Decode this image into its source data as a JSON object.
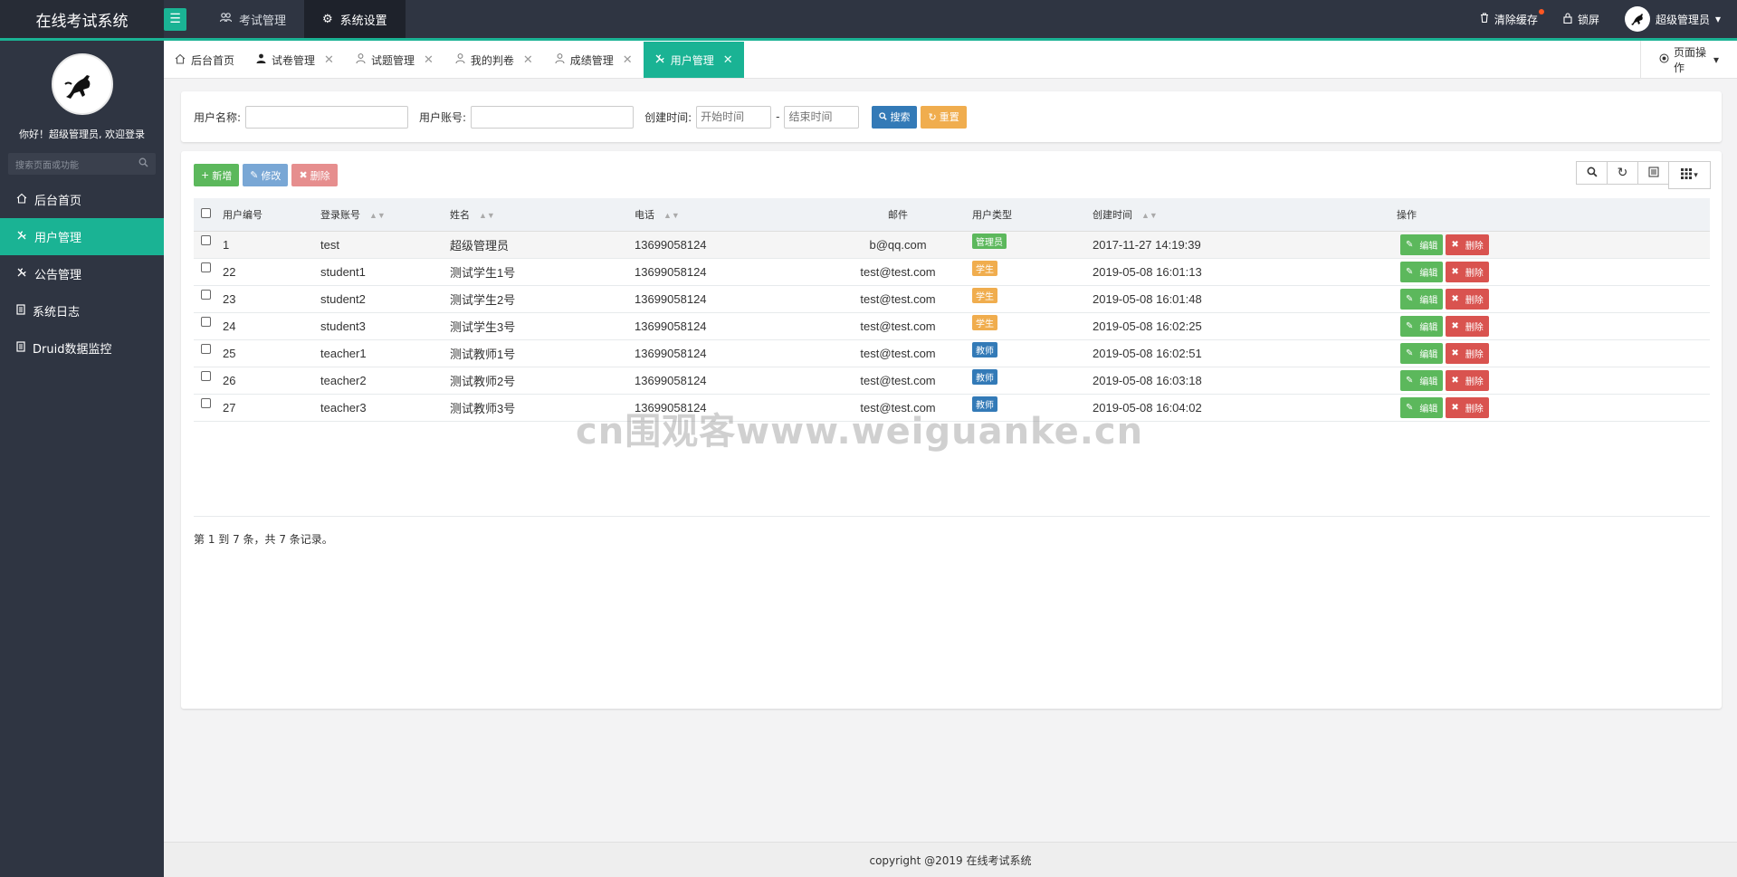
{
  "app": {
    "title": "在线考试系统"
  },
  "topnav": {
    "items": [
      {
        "label": "考试管理",
        "icon": "users-icon",
        "active": false
      },
      {
        "label": "系统设置",
        "icon": "gear-icon",
        "active": true
      }
    ],
    "clear_cache": "清除缓存",
    "lock": "锁屏",
    "user": "超级管理员"
  },
  "sidebar": {
    "welcome": "你好！超级管理员, 欢迎登录",
    "search_placeholder": "搜索页面或功能",
    "items": [
      {
        "label": "后台首页",
        "icon": "home-icon",
        "active": false
      },
      {
        "label": "用户管理",
        "icon": "wrench-icon",
        "active": true
      },
      {
        "label": "公告管理",
        "icon": "wrench-icon",
        "active": false
      },
      {
        "label": "系统日志",
        "icon": "file-icon",
        "active": false
      },
      {
        "label": "Druid数据监控",
        "icon": "file-icon",
        "active": false
      }
    ]
  },
  "tabs": [
    {
      "label": "后台首页",
      "closable": false
    },
    {
      "label": "试卷管理",
      "closable": true
    },
    {
      "label": "试题管理",
      "closable": true
    },
    {
      "label": "我的判卷",
      "closable": true
    },
    {
      "label": "成绩管理",
      "closable": true
    },
    {
      "label": "用户管理",
      "closable": true,
      "active": true
    }
  ],
  "page_ops": "页面操作",
  "search": {
    "username_label": "用户名称:",
    "account_label": "用户账号:",
    "created_label": "创建时间:",
    "start_placeholder": "开始时间",
    "end_placeholder": "结束时间",
    "dash": "-",
    "search_btn": "搜索",
    "reset_btn": "重置"
  },
  "toolbar": {
    "add": "新增",
    "edit": "修改",
    "delete": "删除"
  },
  "table": {
    "headers": [
      "用户编号",
      "登录账号",
      "姓名",
      "电话",
      "邮件",
      "用户类型",
      "创建时间",
      "操作"
    ],
    "rows": [
      {
        "id": "1",
        "account": "test",
        "name": "超级管理员",
        "phone": "13699058124",
        "email": "b@qq.com",
        "type": "管理员",
        "created": "2017-11-27 14:19:39"
      },
      {
        "id": "22",
        "account": "student1",
        "name": "测试学生1号",
        "phone": "13699058124",
        "email": "test@test.com",
        "type": "学生",
        "created": "2019-05-08 16:01:13"
      },
      {
        "id": "23",
        "account": "student2",
        "name": "测试学生2号",
        "phone": "13699058124",
        "email": "test@test.com",
        "type": "学生",
        "created": "2019-05-08 16:01:48"
      },
      {
        "id": "24",
        "account": "student3",
        "name": "测试学生3号",
        "phone": "13699058124",
        "email": "test@test.com",
        "type": "学生",
        "created": "2019-05-08 16:02:25"
      },
      {
        "id": "25",
        "account": "teacher1",
        "name": "测试教师1号",
        "phone": "13699058124",
        "email": "test@test.com",
        "type": "教师",
        "created": "2019-05-08 16:02:51"
      },
      {
        "id": "26",
        "account": "teacher2",
        "name": "测试教师2号",
        "phone": "13699058124",
        "email": "test@test.com",
        "type": "教师",
        "created": "2019-05-08 16:03:18"
      },
      {
        "id": "27",
        "account": "teacher3",
        "name": "测试教师3号",
        "phone": "13699058124",
        "email": "test@test.com",
        "type": "教师",
        "created": "2019-05-08 16:04:02"
      }
    ],
    "row_edit": "编辑",
    "row_delete": "删除"
  },
  "type_colors": {
    "管理员": "#5cb85c",
    "学生": "#f0ad4e",
    "教师": "#337ab7"
  },
  "pagination": "第 1 到 7 条，共 7 条记录。",
  "watermark": "cn围观客www.weiguanke.cn",
  "footer": "copyright @2019 在线考试系统",
  "colors": {
    "accent": "#1ab394",
    "nav": "#2f3542"
  }
}
